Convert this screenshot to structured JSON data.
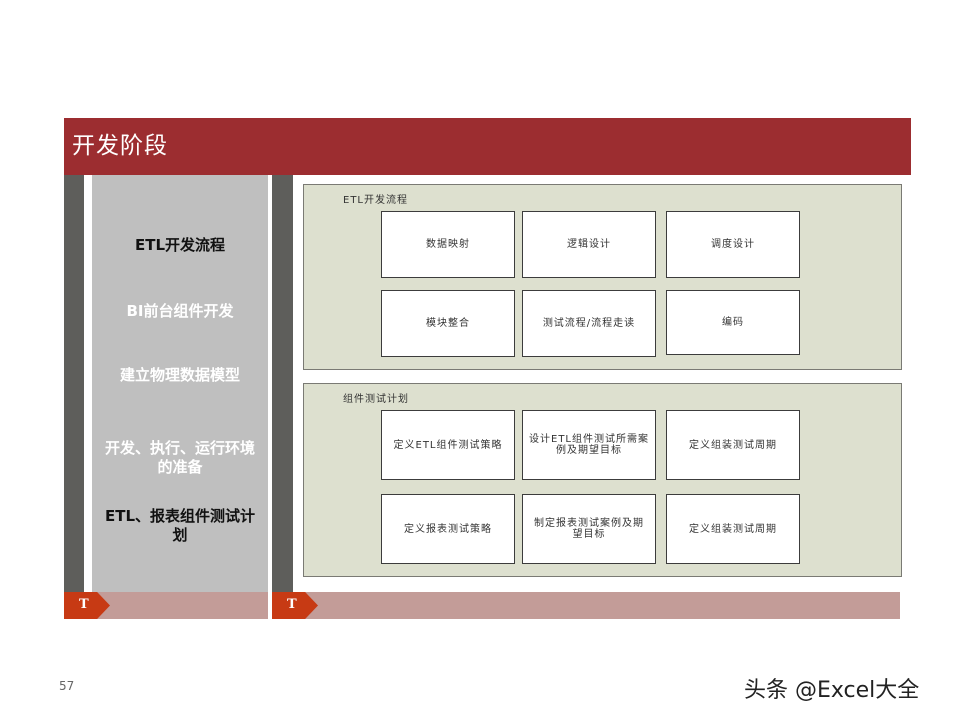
{
  "header": {
    "title": "开发阶段"
  },
  "left_panel": {
    "items": [
      {
        "label": "ETL开发流程"
      },
      {
        "label": "BI前台组件开发"
      },
      {
        "label": "建立物理数据模型"
      },
      {
        "label": "开发、执行、运行环境的准备"
      },
      {
        "label": "ETL、报表组件测试计划"
      }
    ]
  },
  "groups": [
    {
      "title": "ETL开发流程",
      "boxes": [
        "数据映射",
        "逻辑设计",
        "调度设计",
        "模块整合",
        "测试流程/流程走读",
        "编码"
      ]
    },
    {
      "title": "组件测试计划",
      "boxes": [
        "定义ETL组件测试策略",
        "设计ETL组件测试所需案例及期望目标",
        "定义组装测试周期",
        "定义报表测试策略",
        "制定报表测试案例及期望目标",
        "定义组装测试周期"
      ]
    }
  ],
  "footer": {
    "badge_left": "T",
    "badge_right": "T"
  },
  "page_number": "57",
  "watermark": "头条 @Excel大全",
  "colors": {
    "header": "#9c2d30",
    "badge": "#c73a14",
    "footer_band": "#c39c98",
    "group_bg": "#dde0cf"
  }
}
